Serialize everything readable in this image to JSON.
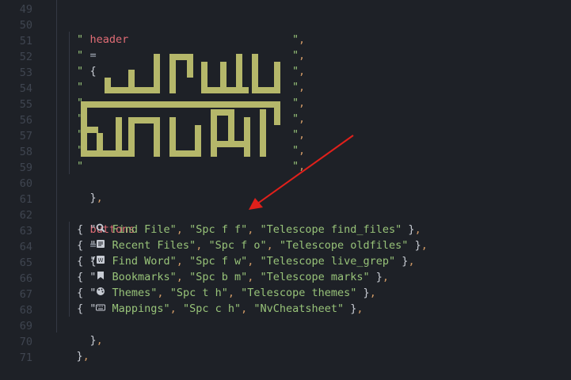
{
  "editor": {
    "line_numbers": [
      "49",
      "50",
      "51",
      "52",
      "53",
      "54",
      "55",
      "56",
      "57",
      "58",
      "59",
      "60",
      "61",
      "62",
      "63",
      "64",
      "65",
      "66",
      "67",
      "68",
      "69",
      "70",
      "71"
    ],
    "header_var": "header",
    "assign": "=",
    "open_brace": "{",
    "header_lines": [
      {
        "open_quote": "\"",
        "close_quote": "\"",
        "comma": ","
      },
      {
        "open_quote": "\"",
        "close_quote": "\"",
        "comma": ","
      },
      {
        "open_quote": "\"",
        "close_quote": "\"",
        "comma": ","
      },
      {
        "open_quote": "\"",
        "close_quote": "\"",
        "comma": ","
      },
      {
        "open_quote": "\"",
        "close_quote": "\"",
        "comma": ","
      },
      {
        "open_quote": "\"",
        "close_quote": "\"",
        "comma": ","
      },
      {
        "open_quote": "\"",
        "close_quote": "\"",
        "comma": ","
      },
      {
        "open_quote": "\"",
        "close_quote": "\"",
        "comma": ","
      },
      {
        "open_quote": "\"",
        "close_quote": "\"",
        "comma": ","
      }
    ],
    "header_close": "}",
    "comma": ",",
    "buttons_var": "buttons",
    "buttons": [
      {
        "icon": "search-icon",
        "label": " Find File\"",
        "key": "\"Spc f f\"",
        "cmd": "\"Telescope find_files\""
      },
      {
        "icon": "file-text-icon",
        "label": " Recent Files\"",
        "key": "\"Spc f o\"",
        "cmd": "\"Telescope oldfiles\""
      },
      {
        "icon": "word-icon",
        "label": " Find Word\"",
        "key": "\"Spc f w\"",
        "cmd": "\"Telescope live_grep\""
      },
      {
        "icon": "bookmark-icon",
        "label": " Bookmarks\"",
        "key": "\"Spc b m\"",
        "cmd": "\"Telescope marks\""
      },
      {
        "icon": "palette-icon",
        "label": " Themes\"",
        "key": "\"Spc t h\"",
        "cmd": "\"Telescope themes\""
      },
      {
        "icon": "keyboard-icon",
        "label": " Mappings\"",
        "key": "\"Spc c h\"",
        "cmd": "\"NvCheatsheet\""
      }
    ],
    "buttons_close": "}",
    "outer_close": "}",
    "open_quote": "{ \"",
    "close_item": " }",
    "sep": ", "
  },
  "colors": {
    "background": "#1e2127",
    "keyword": "#e06c75",
    "string": "#98c379",
    "ascii_art": "#b5b76a",
    "arrow": "#e0201b"
  }
}
